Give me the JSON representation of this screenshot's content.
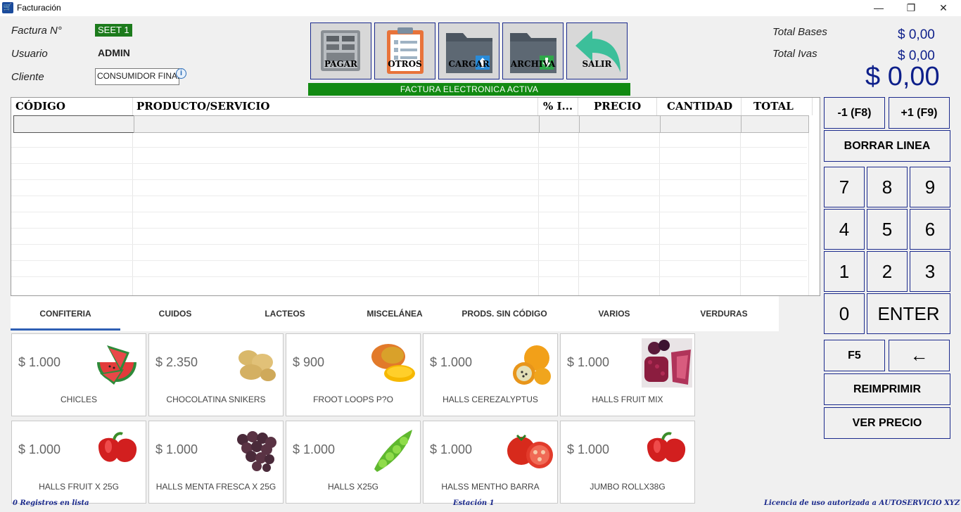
{
  "window": {
    "title": "Facturación",
    "app_icon": "cart-icon",
    "minimize": "—",
    "maximize": "❐",
    "close": "✕"
  },
  "header": {
    "factura_label": "Factura N°",
    "factura_value": "SEET 1",
    "usuario_label": "Usuario",
    "usuario_value": "ADMIN",
    "cliente_label": "Cliente",
    "cliente_value": "CONSUMIDOR FINAL",
    "info_icon": "i"
  },
  "toolbar": {
    "pagar": "PAGAR",
    "otros": "OTROS",
    "cargar": "CARGAR",
    "archiva": "ARCHIVA",
    "salir": "SALIR",
    "banner": "FACTURA ELECTRONICA ACTIVA"
  },
  "totals": {
    "bases_label": "Total Bases",
    "bases_value": "$ 0,00",
    "ivas_label": "Total Ivas",
    "ivas_value": "$ 0,00",
    "grand_total": "$ 0,00"
  },
  "grid": {
    "columns": [
      "CÓDIGO",
      "PRODUCTO/SERVICIO",
      "% I...",
      "PRECIO",
      "CANTIDAD",
      "TOTAL"
    ]
  },
  "keypad": {
    "minus": "-1 (F8)",
    "plus": "+1 (F9)",
    "delete_line": "BORRAR LINEA",
    "digits": [
      "7",
      "8",
      "9",
      "4",
      "5",
      "6",
      "1",
      "2",
      "3",
      "0"
    ],
    "enter": "ENTER",
    "f5": "F5",
    "backspace": "←",
    "reprint": "REIMPRIMIR",
    "view_price": "VER PRECIO"
  },
  "tabs": [
    "CONFITERIA",
    "CUIDOS",
    "LACTEOS",
    "MISCELÁNEA",
    "PRODS. SIN CÓDIGO",
    "VARIOS",
    "VERDURAS"
  ],
  "active_tab": "CONFITERIA",
  "products": [
    {
      "price": "$ 1.000",
      "name": "CHICLES",
      "image": "watermelon"
    },
    {
      "price": "$ 2.350",
      "name": "CHOCOLATINA SNIKERS",
      "image": "potatoes"
    },
    {
      "price": "$ 900",
      "name": "FROOT LOOPS P?O",
      "image": "mango"
    },
    {
      "price": "$ 1.000",
      "name": "HALLS CEREZALYPTUS",
      "image": "passion-fruit"
    },
    {
      "price": "$ 1.000",
      "name": "HALLS FRUIT MIX",
      "image": "berries"
    },
    {
      "price": "$ 1.000",
      "name": "HALLS FRUIT X 25G",
      "image": "red-pepper"
    },
    {
      "price": "$ 1.000",
      "name": "HALLS MENTA FRESCA X 25G",
      "image": "grapes"
    },
    {
      "price": "$ 1.000",
      "name": "HALLS X25G",
      "image": "peas"
    },
    {
      "price": "$ 1.000",
      "name": "HALSS MENTHO BARRA",
      "image": "tomato"
    },
    {
      "price": "$ 1.000",
      "name": "JUMBO ROLLX38G",
      "image": "red-pepper"
    }
  ],
  "status": {
    "records": "0 Registros en lista",
    "station": "Estación 1",
    "license": "Licencia de uso autorizada a AUTOSERVICIO XYZ"
  },
  "colors": {
    "accent_blue": "#0d1f8a",
    "banner_green": "#128a12",
    "tab_underline": "#2f5fb4"
  }
}
